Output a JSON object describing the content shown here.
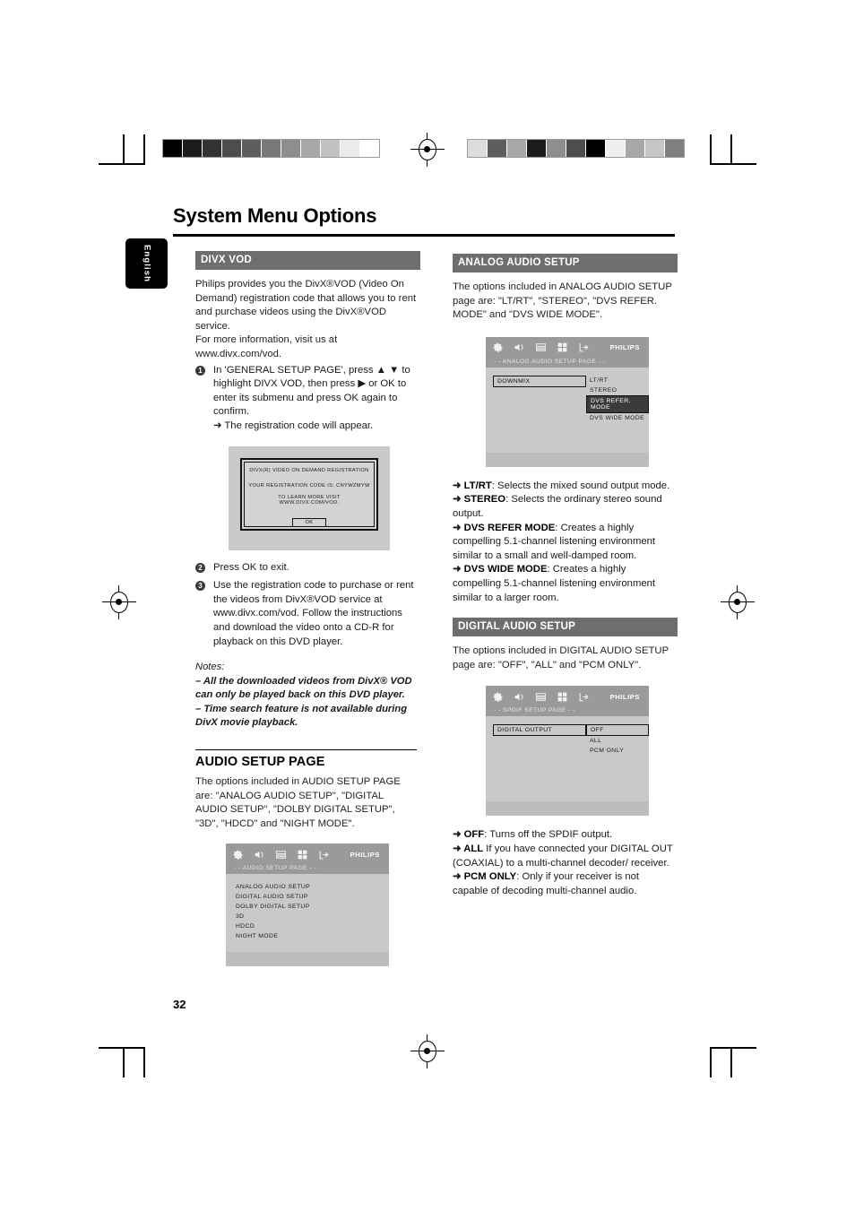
{
  "page": {
    "title": "System Menu Options",
    "language_tab": "English",
    "page_number": "32"
  },
  "colorbars": {
    "left": [
      "#000000",
      "#1c1c1c",
      "#333333",
      "#4d4d4d",
      "#5e5e5e",
      "#787878",
      "#8e8e8e",
      "#a8a8a8",
      "#c2c2c2",
      "#ebebeb",
      "#ffffff"
    ],
    "right": [
      "#dcdcdc",
      "#5e5e5e",
      "#a8a8a8",
      "#1c1c1c",
      "#8e8e8e",
      "#4d4d4d",
      "#000000",
      "#efefef",
      "#a8a8a8",
      "#c6c6c6",
      "#808080"
    ]
  },
  "left_column": {
    "divx_vod": {
      "heading": "DIVX  VOD",
      "intro": "Philips provides you the DivX®VOD (Video On Demand) registration code that allows you to rent and purchase videos using the DivX®VOD service.",
      "intro2": "For more information, visit us at www.divx.com/vod.",
      "steps": [
        {
          "num": "1",
          "text": "In 'GENERAL SETUP PAGE', press ▲ ▼ to highlight DIVX VOD, then press ▶ or OK to enter its submenu and press OK again to confirm.",
          "sub": "➜ The registration code will appear."
        },
        {
          "num": "2",
          "text": "Press OK to exit."
        },
        {
          "num": "3",
          "text": "Use the registration code to purchase or rent the videos from DivX®VOD service at www.divx.com/vod. Follow the instructions and download the video onto a CD-R for playback on this DVD player."
        }
      ],
      "notes_title": "Notes:",
      "notes": [
        "–   All the downloaded videos from DivX® VOD can only be played back on this DVD player.",
        "–   Time search feature is not available during DivX movie playback."
      ],
      "registration_screen": {
        "title": "DIVX(R) VIDEO ON DEMAND REGISTRATION",
        "code_line": "YOUR REGISTRATION CODE IS:  CNYWZMYW",
        "learn_line": "TO LEARN MORE  VISIT  WWW.DIVX.COM/VOD.",
        "ok_label": "OK"
      }
    },
    "audio_setup_page": {
      "heading": "AUDIO SETUP PAGE",
      "body": "The options included in AUDIO SETUP PAGE are: \"ANALOG AUDIO SETUP\", \"DIGITAL AUDIO SETUP\", \"DOLBY DIGITAL SETUP\", \"3D\", \"HDCD\" and \"NIGHT MODE\".",
      "osd": {
        "brand": "PHILIPS",
        "breadcrumb": "- -  AUDIO  SETUP  PAGE  - -",
        "rows": [
          "ANALOG AUDIO SETUP",
          "DIGITAL AUDIO SETUP",
          "DOLBY DIGITAL SETUP",
          "3D",
          "HDCD",
          "NIGHT MODE"
        ]
      }
    }
  },
  "right_column": {
    "analog_audio_setup": {
      "heading": "ANALOG AUDIO SETUP",
      "body": "The options included in ANALOG AUDIO SETUP page are: \"LT/RT\", \"STEREO\", \"DVS REFER. MODE\" and \"DVS WIDE MODE\".",
      "osd": {
        "brand": "PHILIPS",
        "breadcrumb": "- -  ANALOG AUDIO SETUP PAGE - -",
        "label": "DOWNMIX",
        "options": [
          "LT/RT",
          "STEREO",
          "DVS REFER. MODE",
          "DVS WIDE MODE"
        ],
        "selected": "DVS REFER. MODE"
      },
      "items": [
        {
          "term": "LT/RT",
          "desc": ": Selects the mixed sound output mode."
        },
        {
          "term": "STEREO",
          "desc": ": Selects the ordinary stereo sound output."
        },
        {
          "term": "DVS REFER MODE",
          "desc": ": Creates a highly compelling 5.1-channel listening environment similar to a small and well-damped room."
        },
        {
          "term": "DVS WIDE MODE",
          "desc": ": Creates a highly compelling 5.1-channel listening environment similar to a larger room."
        }
      ]
    },
    "digital_audio_setup": {
      "heading": "DIGITAL AUDIO SETUP",
      "body": "The options included in DIGITAL AUDIO SETUP page are: \"OFF\", \"ALL\" and \"PCM ONLY\".",
      "osd": {
        "brand": "PHILIPS",
        "breadcrumb": "- -  SPDIF SETUP PAGE  - -",
        "label": "DIGITAL OUTPUT",
        "options": [
          "OFF",
          "ALL",
          "PCM ONLY"
        ],
        "selected": "OFF"
      },
      "items": [
        {
          "term": "OFF",
          "desc": ": Turns off the SPDIF output."
        },
        {
          "term": "ALL",
          "desc": " If you have connected your DIGITAL OUT (COAXIAL) to a multi-channel decoder/ receiver."
        },
        {
          "term": "PCM ONLY",
          "desc": ": Only if your receiver is not capable of decoding multi-channel audio."
        }
      ]
    }
  },
  "icons": {
    "gear": "gear-icon",
    "speaker": "speaker-icon",
    "video": "video-icon",
    "preferences": "preferences-grid-icon",
    "exit": "exit-arrow-icon"
  }
}
